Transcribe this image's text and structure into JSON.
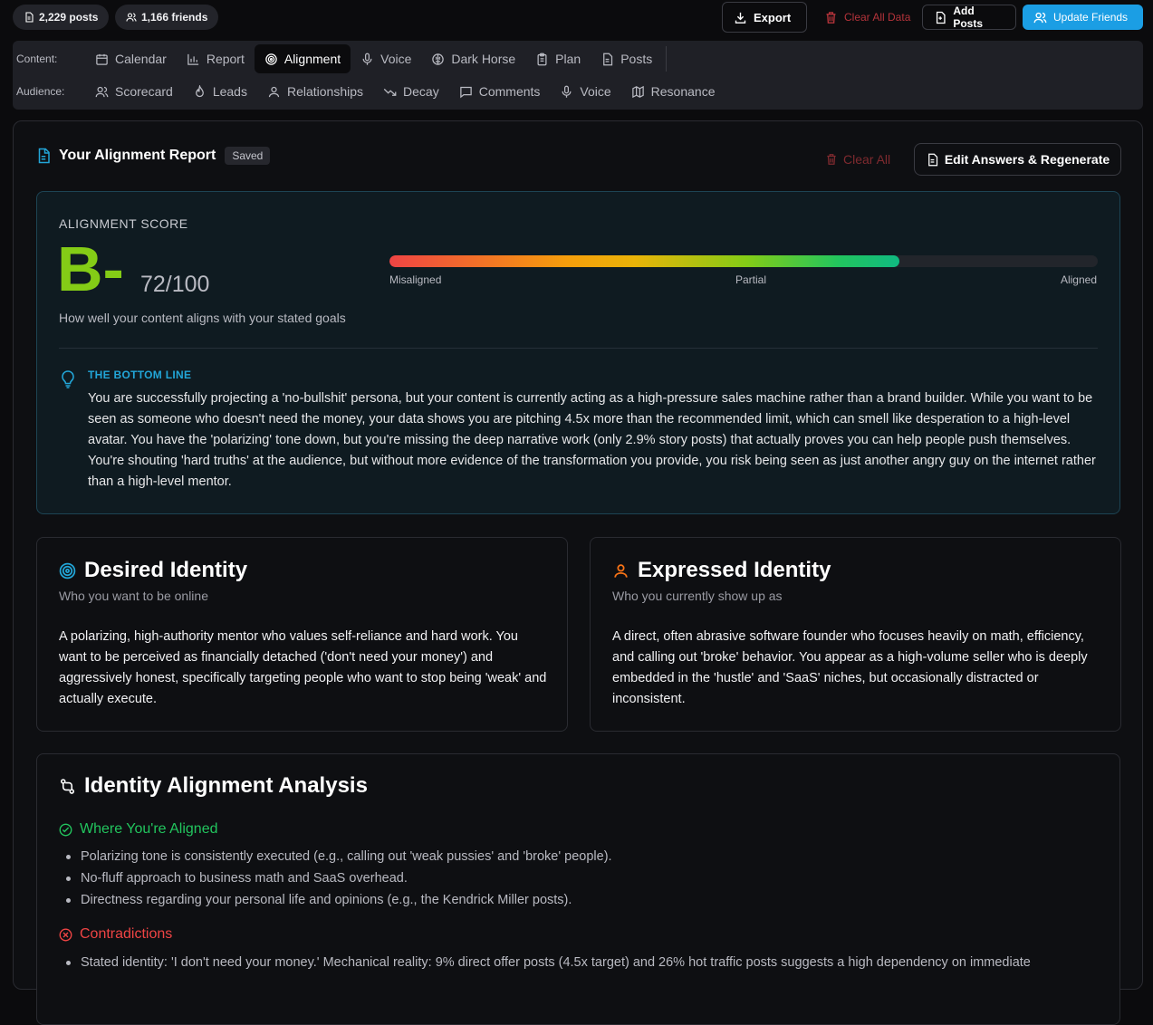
{
  "topbar": {
    "posts_count": "2,229 posts",
    "friends_count": "1,166 friends",
    "export_label": "Export",
    "clear_all_data_label": "Clear All Data",
    "add_posts_label": "Add Posts",
    "update_friends_label": "Update Friends"
  },
  "nav": {
    "content_label": "Content:",
    "content_items": [
      {
        "label": "Calendar",
        "icon": "calendar-icon"
      },
      {
        "label": "Report",
        "icon": "bar-chart-icon"
      },
      {
        "label": "Alignment",
        "icon": "target-icon",
        "active": true
      },
      {
        "label": "Voice",
        "icon": "mic-icon"
      },
      {
        "label": "Dark Horse",
        "icon": "brain-icon"
      },
      {
        "label": "Plan",
        "icon": "clipboard-icon"
      },
      {
        "label": "Posts",
        "icon": "document-icon"
      }
    ],
    "audience_label": "Audience:",
    "audience_items": [
      {
        "label": "Scorecard",
        "icon": "users-icon"
      },
      {
        "label": "Leads",
        "icon": "flame-icon"
      },
      {
        "label": "Relationships",
        "icon": "user-icon"
      },
      {
        "label": "Decay",
        "icon": "trending-down-icon"
      },
      {
        "label": "Comments",
        "icon": "message-icon"
      },
      {
        "label": "Voice",
        "icon": "mic-icon"
      },
      {
        "label": "Resonance",
        "icon": "map-icon"
      }
    ]
  },
  "report": {
    "title": "Your Alignment Report",
    "saved_badge": "Saved",
    "clear_all_label": "Clear All",
    "edit_button_label": "Edit Answers & Regenerate"
  },
  "score": {
    "label": "ALIGNMENT SCORE",
    "grade": "B-",
    "value": "72/100",
    "progress": 0.72,
    "description": "How well your content aligns with your stated goals",
    "scale_left": "Misaligned",
    "scale_mid": "Partial",
    "scale_right": "Aligned"
  },
  "bottom_line": {
    "title": "THE BOTTOM LINE",
    "text": "You are successfully projecting a 'no-bullshit' persona, but your content is currently acting as a high-pressure sales machine rather than a brand builder. While you want to be seen as someone who doesn't need the money, your data shows you are pitching 4.5x more than the recommended limit, which can smell like desperation to a high-level avatar. You have the 'polarizing' tone down, but you're missing the deep narrative work (only 2.9% story posts) that actually proves you can help people push themselves. You're shouting 'hard truths' at the audience, but without more evidence of the transformation you provide, you risk being seen as just another angry guy on the internet rather than a high-level mentor."
  },
  "desired_identity": {
    "title": "Desired Identity",
    "subtitle": "Who you want to be online",
    "body": "A polarizing, high-authority mentor who values self-reliance and hard work. You want to be perceived as financially detached ('don't need your money') and aggressively honest, specifically targeting people who want to stop being 'weak' and actually execute."
  },
  "expressed_identity": {
    "title": "Expressed Identity",
    "subtitle": "Who you currently show up as",
    "body": "A direct, often abrasive software founder who focuses heavily on math, efficiency, and calling out 'broke' behavior. You appear as a high-volume seller who is deeply embedded in the 'hustle' and 'SaaS' niches, but occasionally distracted or inconsistent."
  },
  "analysis": {
    "title": "Identity Alignment Analysis",
    "aligned_title": "Where You're Aligned",
    "aligned_items": [
      "Polarizing tone is consistently executed (e.g., calling out 'weak pussies' and 'broke' people).",
      "No-fluff approach to business math and SaaS overhead.",
      "Directness regarding your personal life and opinions (e.g., the Kendrick Miller posts)."
    ],
    "contradictions_title": "Contradictions",
    "contradiction_items": [
      "Stated identity: 'I don't need your money.' Mechanical reality: 9% direct offer posts (4.5x target) and 26% hot traffic posts suggests a high dependency on immediate"
    ]
  },
  "colors": {
    "accent": "#1b9ee4",
    "grade": "#84cc16",
    "danger": "#ef4444",
    "success": "#22c55e"
  }
}
